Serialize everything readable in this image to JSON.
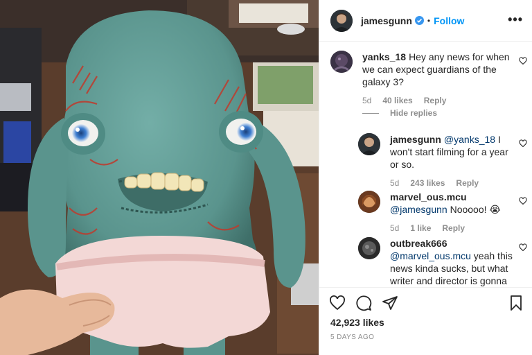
{
  "post": {
    "username": "jamesgunn",
    "follow_label": "Follow",
    "separator": "•",
    "more_label": "•••",
    "likes": "42,923 likes",
    "timestamp": "5 DAYS AGO"
  },
  "comments": [
    {
      "username": "yanks_18",
      "text": "Hey any news for when we can expect guardians of the galaxy 3?",
      "age": "5d",
      "likes": "40 likes",
      "reply_label": "Reply",
      "hide_replies_label": "Hide replies"
    },
    {
      "username": "jamesgunn",
      "mention": "@yanks_18",
      "text": " I won't start filming for a year or so.",
      "age": "5d",
      "likes": "243 likes",
      "reply_label": "Reply"
    },
    {
      "username": "marvel_ous.mcu",
      "mention": "@jamesgunn",
      "text": " Nooooo! 😭",
      "age": "5d",
      "likes": "1 like",
      "reply_label": "Reply"
    },
    {
      "username": "outbreak666",
      "mention": "@marvel_ous.mcu",
      "text": " yeah this news kinda sucks, but what writer and director is gonna"
    }
  ],
  "colors": {
    "accent": "#0095f6",
    "mention": "#00376b",
    "muted": "#8e8e8e",
    "plush": "#5f9a94"
  }
}
